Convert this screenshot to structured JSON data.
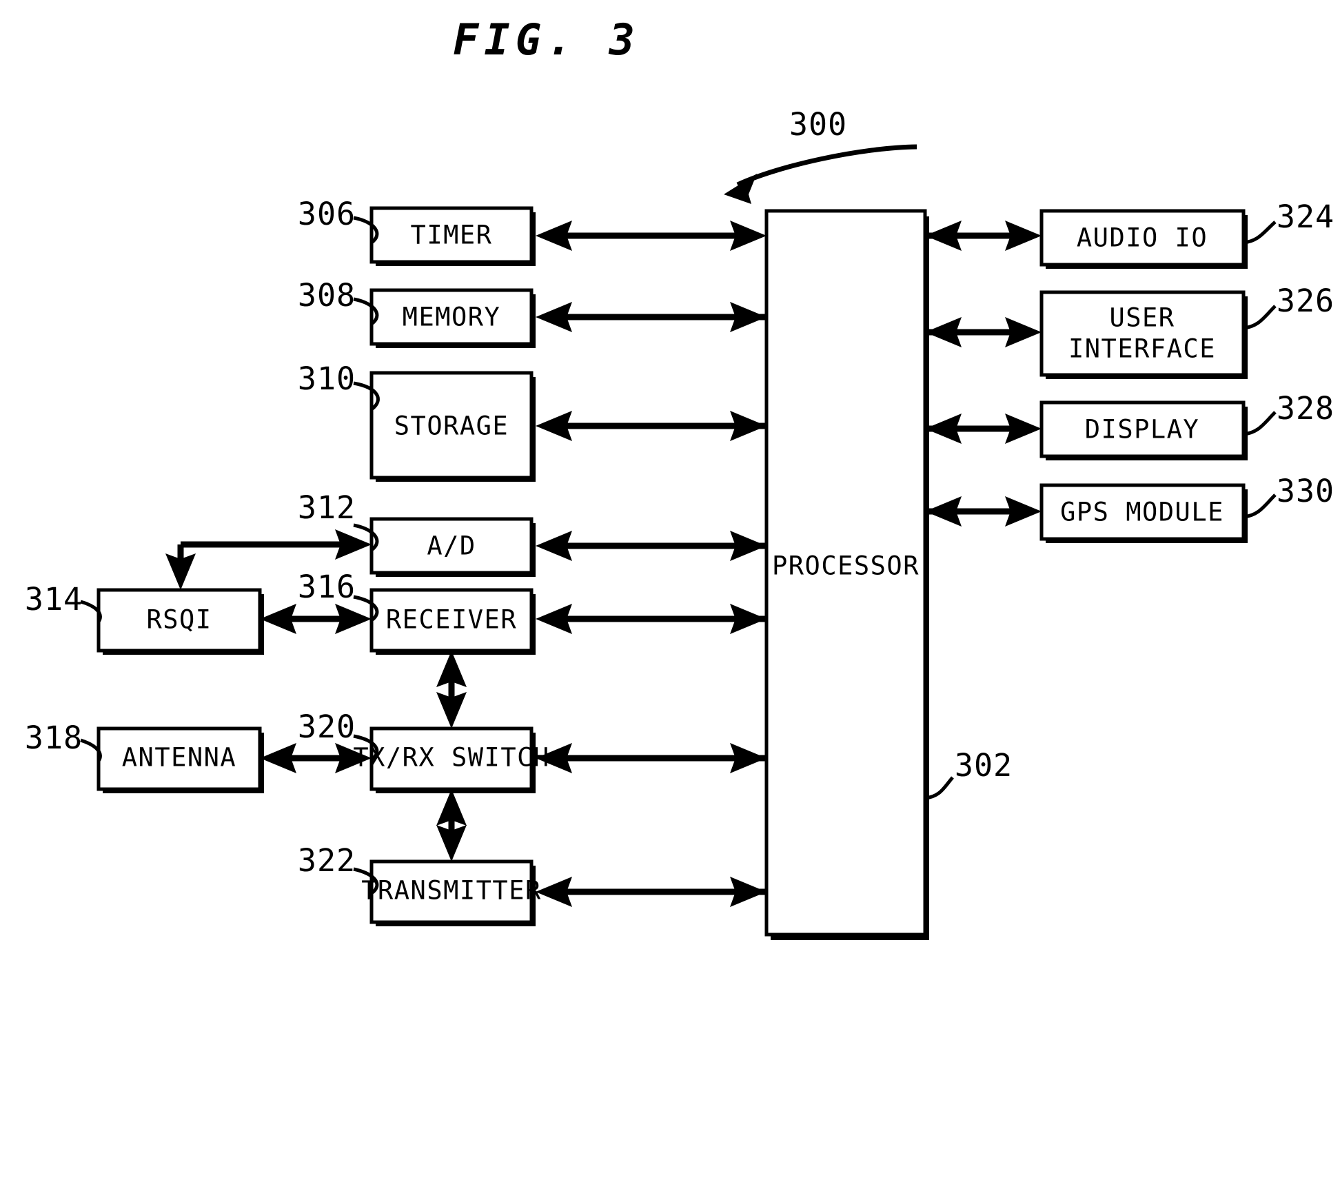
{
  "figure": {
    "title": "FIG. 3",
    "system_ref": "300"
  },
  "blocks": {
    "processor": {
      "label": "PROCESSOR",
      "ref": "302"
    },
    "timer": {
      "label": "TIMER",
      "ref": "306"
    },
    "memory": {
      "label": "MEMORY",
      "ref": "308"
    },
    "storage": {
      "label": "STORAGE",
      "ref": "310"
    },
    "ad": {
      "label": "A/D",
      "ref": "312"
    },
    "rsqi": {
      "label": "RSQI",
      "ref": "314"
    },
    "receiver": {
      "label": "RECEIVER",
      "ref": "316"
    },
    "antenna": {
      "label": "ANTENNA",
      "ref": "318"
    },
    "txrx_switch": {
      "label": "TX/RX SWITCH",
      "ref": "320"
    },
    "transmitter": {
      "label": "TRANSMITTER",
      "ref": "322"
    },
    "audio_io": {
      "label": "AUDIO IO",
      "ref": "324"
    },
    "user_interface_line1": "USER",
    "user_interface_line2": "INTERFACE",
    "user_interface_ref": "326",
    "display": {
      "label": "DISPLAY",
      "ref": "328"
    },
    "gps_module": {
      "label": "GPS MODULE",
      "ref": "330"
    }
  },
  "colors": {
    "ink": "#000000",
    "paper": "#ffffff"
  }
}
